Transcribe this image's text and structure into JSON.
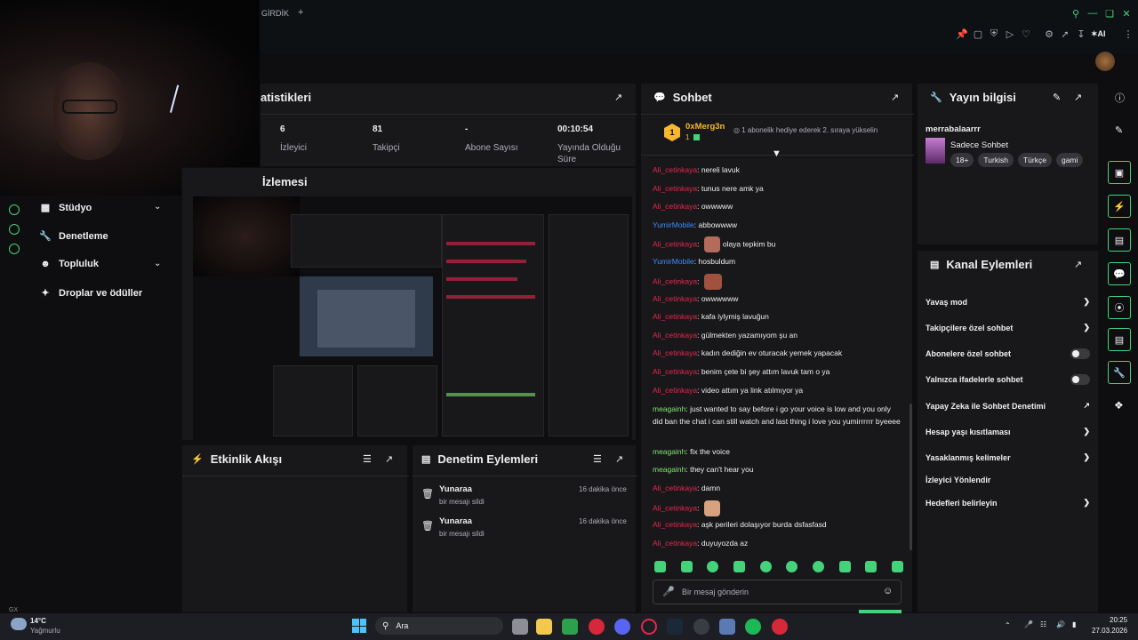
{
  "browser": {
    "tab_label": "GİRDİK",
    "new_tab": "+",
    "extensions_label": "AI"
  },
  "nav": {
    "items": [
      {
        "label": "Stüdyo",
        "icon": "studio-icon",
        "has_chevron": true
      },
      {
        "label": "Denetleme",
        "icon": "wrench-icon",
        "has_chevron": false
      },
      {
        "label": "Topluluk",
        "icon": "community-icon",
        "has_chevron": true
      },
      {
        "label": "Droplar ve ödüller",
        "icon": "drops-icon",
        "has_chevron": false
      }
    ]
  },
  "stats": {
    "title": "atistikleri",
    "items": [
      {
        "value": "6",
        "label": "İzleyici"
      },
      {
        "value": "81",
        "label": "Takipçi"
      },
      {
        "value": "-",
        "label": "Abone Sayısı"
      },
      {
        "value": "00:10:54",
        "label": "Yayında Olduğu Süre"
      }
    ]
  },
  "preview": {
    "title": "İzlemesi"
  },
  "activity": {
    "title": "Etkinlik Akışı"
  },
  "mod_actions": {
    "title": "Denetim Eylemleri",
    "items": [
      {
        "user": "Yunaraa",
        "action": "bir mesajı sildi",
        "time": "16 dakika önce"
      },
      {
        "user": "Yunaraa",
        "action": "bir mesajı sildi",
        "time": "16 dakika önce"
      }
    ]
  },
  "chat": {
    "title": "Sohbet",
    "gift_user": "0xMerg3n",
    "gift_count": "1",
    "gift_text": "1 abonelik hediye ederek 2. sıraya yükselin",
    "input_placeholder": "Bir mesaj gönderin",
    "messages": [
      {
        "user": "Ali_cetinkaya",
        "color": "#e8264d",
        "text": "nereli lavuk"
      },
      {
        "user": "Ali_cetinkaya",
        "color": "#e8264d",
        "text": "tunus nere amk ya"
      },
      {
        "user": "Ali_cetinkaya",
        "color": "#e8264d",
        "text": "owwwww"
      },
      {
        "user": "YumirMobile",
        "color": "#3d8bff",
        "text": "abbowwww"
      },
      {
        "user": "Ali_cetinkaya",
        "color": "#e8264d",
        "text": "olaya tepkim bu"
      },
      {
        "user": "YumirMobile",
        "color": "#3d8bff",
        "text": "hosbuldum"
      },
      {
        "user": "Ali_cetinkaya",
        "color": "#e8264d",
        "text": ""
      },
      {
        "user": "Ali_cetinkaya",
        "color": "#e8264d",
        "text": "owwwwww"
      },
      {
        "user": "Ali_cetinkaya",
        "color": "#e8264d",
        "text": "kafa iylymiş lavuğun"
      },
      {
        "user": "Ali_cetinkaya",
        "color": "#e8264d",
        "text": "gülmekten yazamıyom şu an"
      },
      {
        "user": "Ali_cetinkaya",
        "color": "#e8264d",
        "text": "kadın dediğin ev oturacak yemek yapacak"
      },
      {
        "user": "Ali_cetinkaya",
        "color": "#e8264d",
        "text": "benim çete bi şey attım lavuk tam o ya"
      },
      {
        "user": "Ali_cetinkaya",
        "color": "#e8264d",
        "text": "video attım ya link atılmıyor ya"
      },
      {
        "user": "meagainh",
        "color": "#7fe36f",
        "text": "just wanted to say before i go your voice is low and you only did ban the chat i can still watch and last thing i love you yumirrrrrr byeeee"
      },
      {
        "user": "meagainh",
        "color": "#7fe36f",
        "text": "fix the voice"
      },
      {
        "user": "meagainh",
        "color": "#7fe36f",
        "text": "they can't hear you"
      },
      {
        "user": "Ali_cetinkaya",
        "color": "#e8264d",
        "text": "damn"
      },
      {
        "user": "Ali_cetinkaya",
        "color": "#e8264d",
        "text": ""
      },
      {
        "user": "Ali_cetinkaya",
        "color": "#e8264d",
        "text": "aşk perileri dolaşıyor burda dsfasfasd"
      },
      {
        "user": "Ali_cetinkaya",
        "color": "#e8264d",
        "text": "duyuyozda az"
      }
    ]
  },
  "stream_info": {
    "title": "Yayın bilgisi",
    "stream_title": "merrabalaarrr",
    "category": "Sadece Sohbet",
    "tags": [
      "18+",
      "Turkish",
      "Türkçe",
      "gami"
    ]
  },
  "channel_actions": {
    "title": "Kanal Eylemleri",
    "items": [
      {
        "label": "Yavaş mod",
        "control": "chevron"
      },
      {
        "label": "Takipçilere özel sohbet",
        "control": "chevron"
      },
      {
        "label": "Abonelere özel sohbet",
        "control": "toggle"
      },
      {
        "label": "Yalnızca ifadelerle sohbet",
        "control": "toggle"
      },
      {
        "label": "Yapay Zeka ile Sohbet Denetimi",
        "control": "external"
      },
      {
        "label": "Hesap yaşı kısıtlaması",
        "control": "chevron"
      },
      {
        "label": "Yasaklanmış kelimeler",
        "control": "chevron"
      },
      {
        "label": "İzleyici Yönlendir",
        "control": "none"
      },
      {
        "label": "Hedefleri belirleyin",
        "control": "chevron"
      }
    ]
  },
  "taskbar": {
    "weather_temp": "14°C",
    "weather_desc": "Yağmurlu",
    "search_label": "Ara",
    "time": "20:25",
    "date": "27.03.2026",
    "webcam_badge": "GX"
  },
  "colors": {
    "accent_green": "#44d27a",
    "panel_bg": "#18181b",
    "page_bg": "#0e0e10",
    "username_red": "#e8264d",
    "username_blue": "#3d8bff",
    "username_green": "#7fe36f"
  }
}
